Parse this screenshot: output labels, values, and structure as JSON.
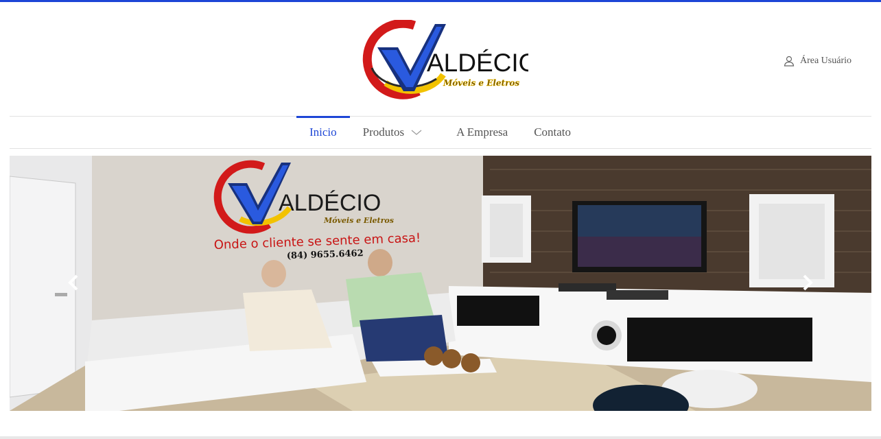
{
  "brand": {
    "name_initial": "V",
    "name_rest": "ALDÉCIO",
    "tagline": "Móveis e Eletros",
    "colors": {
      "blue": "#1d46d6",
      "red": "#d21a1a",
      "yellow": "#f2c200",
      "navy": "#17317f"
    }
  },
  "header": {
    "user_area_label": "Área Usuário",
    "user_icon": "user-icon"
  },
  "nav": {
    "items": [
      {
        "label": "Inicio",
        "active": true
      },
      {
        "label": "Produtos",
        "dropdown": true
      },
      {
        "label": "A Empresa"
      },
      {
        "label": "Contato"
      }
    ]
  },
  "slider": {
    "slide_sign": {
      "slogan": "Onde o cliente se sente em casa!",
      "phone": "(84) 9655.6462"
    },
    "prev_icon": "chevron-left-icon",
    "next_icon": "chevron-right-icon"
  }
}
